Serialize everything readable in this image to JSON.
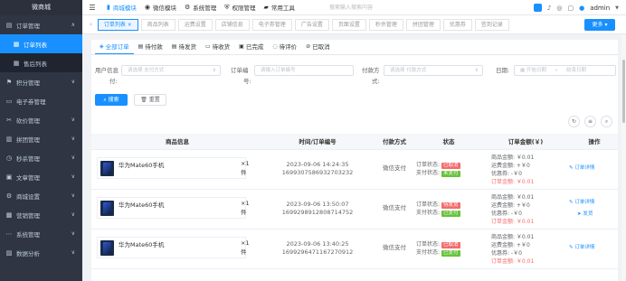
{
  "app": {
    "title": "微商城"
  },
  "sidebar": {
    "items": [
      {
        "label": "订单管理",
        "icon": "doc-icon",
        "arrow": "∧"
      },
      {
        "label": "订单列表",
        "icon": "list-icon",
        "active": true
      },
      {
        "label": "售后列表",
        "icon": "list-icon"
      },
      {
        "label": "积分管理",
        "icon": "flag-icon",
        "arrow": "∨"
      },
      {
        "label": "电子券管理",
        "icon": "ticket-icon"
      },
      {
        "label": "砍价管理",
        "icon": "scissor-icon",
        "arrow": "∨"
      },
      {
        "label": "拼团管理",
        "icon": "group-icon",
        "arrow": "∨"
      },
      {
        "label": "秒杀管理",
        "icon": "clock-icon",
        "arrow": "∨"
      },
      {
        "label": "文章管理",
        "icon": "article-icon",
        "arrow": "∨"
      },
      {
        "label": "商城设置",
        "icon": "gear-icon",
        "arrow": "∨"
      },
      {
        "label": "营销管理",
        "icon": "market-icon",
        "arrow": "∨"
      },
      {
        "label": "系统管理",
        "icon": "system-icon",
        "arrow": "∨"
      },
      {
        "label": "数据分析",
        "icon": "chart-icon",
        "arrow": "∨"
      }
    ]
  },
  "topbar": {
    "modules": [
      {
        "label": "商城模块",
        "active": true
      },
      {
        "label": "微信模块"
      },
      {
        "label": "系统管理"
      },
      {
        "label": "权限管理"
      },
      {
        "label": "常用工具"
      }
    ],
    "search_placeholder": "搜索输入搜索内容",
    "user": "admin"
  },
  "tabs": {
    "items": [
      "订单列表 ×",
      "商品列表",
      "运费设置",
      "店铺信息",
      "电子券管理",
      "广告设置",
      "页面设置",
      "秒杀管理",
      "拼团管理",
      "优惠券",
      "签到记录"
    ],
    "more": "更多 ▾"
  },
  "status_tabs": [
    "全部订单",
    "待付款",
    "待发货",
    "待收货",
    "已完成",
    "待评价",
    "已取消"
  ],
  "filter": {
    "userinfo_label": "用户信息",
    "userinfo_label2": "付:",
    "userinfo_placeholder": "请选择 支付方式",
    "orderno_label": "订单编",
    "orderno_label2": "号:",
    "orderno_placeholder": "请输入订单编号",
    "paytype_label": "付款方",
    "paytype_label2": "式:",
    "paytype_placeholder": "请选择 付款方式",
    "date_label": "日期:",
    "date_start": "开始日期",
    "date_sep": "-",
    "date_end": "结束日期",
    "search_btn": "搜索",
    "reset_btn": "重置"
  },
  "table": {
    "headers": [
      "商品信息",
      "时间/订单编号",
      "付款方式",
      "状态",
      "订单金额(￥)",
      "操作"
    ],
    "rows": [
      {
        "product": "华为Mate60手机",
        "qty": "×1件",
        "time": "2023-09-06 14:24:35",
        "order_no": "1699307586932703232",
        "pay": "微信支付",
        "order_status_label": "订单状态:",
        "order_status": "已取消",
        "order_status_color": "#f56c6c",
        "pay_status_label": "支付状态:",
        "pay_status": "未支付",
        "pay_status_color": "#67c23a",
        "goods_amount": "商品金额: ￥0.01",
        "freight": "运费金额: +￥0",
        "discount": "优惠券: -￥0",
        "total": "订单金额: ￥0.01",
        "op1": "✎ 订单详情",
        "op2": ""
      },
      {
        "product": "华为Mate60手机",
        "qty": "×1件",
        "time": "2023-09-06 13:50:07",
        "order_no": "1699298912808714752",
        "pay": "微信支付",
        "order_status_label": "订单状态:",
        "order_status": "待发货",
        "order_status_color": "#f56c6c",
        "pay_status_label": "支付状态:",
        "pay_status": "已支付",
        "pay_status_color": "#67c23a",
        "goods_amount": "商品金额: ￥0.01",
        "freight": "运费金额: +￥0",
        "discount": "优惠券: -￥0",
        "total": "订单金额: ￥0.01",
        "op1": "✎ 订单详情",
        "op2": "➤ 发货"
      },
      {
        "product": "华为Mate60手机",
        "qty": "×1件",
        "time": "2023-09-06 13:40:25",
        "order_no": "1699296471167270912",
        "pay": "微信支付",
        "order_status_label": "订单状态:",
        "order_status": "已取消",
        "order_status_color": "#f56c6c",
        "pay_status_label": "支付状态:",
        "pay_status": "已支付",
        "pay_status_color": "#67c23a",
        "goods_amount": "商品金额: ￥0.01",
        "freight": "运费金额: +￥0",
        "discount": "优惠券: -￥0",
        "total": "订单金额: ￥0.01",
        "op1": "✎ 订单详情",
        "op2": ""
      }
    ]
  }
}
